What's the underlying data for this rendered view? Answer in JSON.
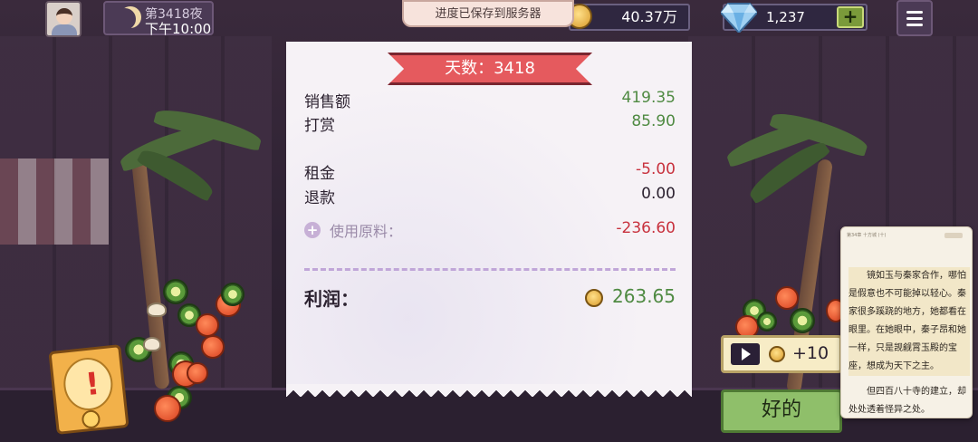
{
  "top_bar": {
    "day_label": "第3418夜",
    "time_label": "下午10:00",
    "toast": "进度已保存到服务器",
    "coins": "40.37万",
    "gems": "1,237",
    "gem_plus": "+"
  },
  "receipt": {
    "ribbon": "天数：3418",
    "rows": [
      {
        "label": "销售额",
        "value": "419.35",
        "tone": "pos"
      },
      {
        "label": "打赏",
        "value": "85.90",
        "tone": "pos"
      },
      {
        "label": "租金",
        "value": "-5.00",
        "tone": "neg"
      },
      {
        "label": "退款",
        "value": "0.00",
        "tone": "neu"
      },
      {
        "label": "使用原料：",
        "value": "-236.60",
        "tone": "neg",
        "expand_symbol": "+"
      }
    ],
    "profit_label": "利润：",
    "profit_value": "263.65"
  },
  "actions": {
    "ad_reward": "+10",
    "ok_label": "好的",
    "alert_mark": "!"
  },
  "reader": {
    "header": "第34章  十方城  (十)",
    "paragraphs": [
      "镜如玉与秦家合作，哪怕是假意也不可能掉以轻心。秦家很多蹊跷的地方，她都看在眼里。在她眼中，秦子昂和她一样，只是觊觎霄玉殿的宝座，想成为天下之主。",
      "但四百八十寺的建立，却处处透着怪异之处。"
    ]
  },
  "icons": {
    "avatar": "avatar",
    "moon": "moon-icon",
    "coin": "coin-icon",
    "gem": "diamond-icon",
    "menu": "hamburger-menu-icon",
    "play": "play-video-icon",
    "alert": "exclamation-alert-icon"
  },
  "colors": {
    "positive": "#4f8a42",
    "negative": "#c8323e",
    "ribbon": "#e55a5e",
    "ok_button": "#8fbf6a"
  }
}
